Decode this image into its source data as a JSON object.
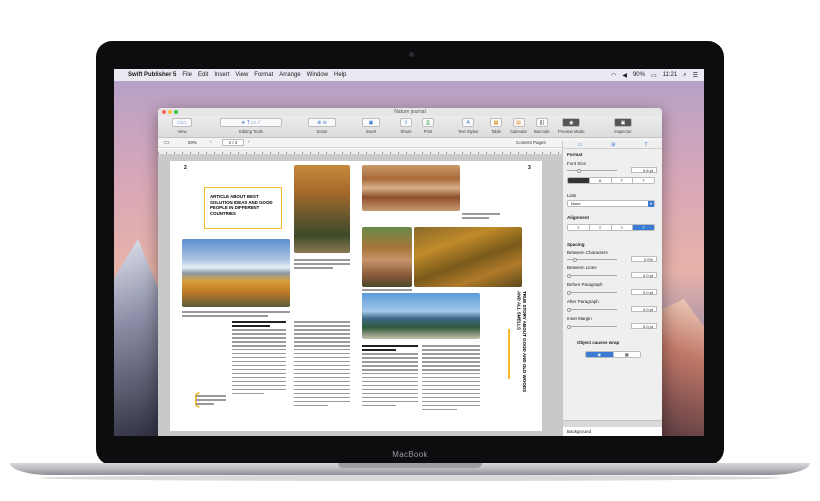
{
  "laptop": {
    "brand_label": "MacBook"
  },
  "menubar": {
    "app_name": "Swift Publisher 5",
    "items": [
      "File",
      "Edit",
      "Insert",
      "View",
      "Format",
      "Arrange",
      "Window",
      "Help"
    ],
    "battery": "90%",
    "time": "11:21"
  },
  "window": {
    "title": "Nature journal",
    "toolbar": {
      "view": "View",
      "editing_tools": "Editing Tools",
      "zoom": "Zoom",
      "insert": "Insert",
      "share": "Share",
      "print": "Print",
      "text_styles": "Text Styles",
      "table": "Table",
      "calendar": "Calendar",
      "barcode": "Barcode",
      "preview_mode": "Preview Mode",
      "inspector": "Inspector"
    },
    "subbar": {
      "zoom_value": "50%",
      "page_value": "2 / 4",
      "content_pages": "Content Pages"
    }
  },
  "document": {
    "left_page_number": "2",
    "right_page_number": "3",
    "headline": "ARTICLE ABOUT BEST SOLUTION IDEAS AND GOOD PEOPLE IN DIFFERENT COUNTRIES",
    "vertical_title": "TRUE STORY ABOUT GOOD AND OLD WOODS AND ALL SMELLS",
    "colors": {
      "accent_yellow": "#f2b827"
    }
  },
  "inspector": {
    "format_label": "Format",
    "font_size_label": "Font Size",
    "font_size_value": "9.6 pt",
    "lists_label": "Lists",
    "lists_value": "None",
    "alignment_label": "Alignment",
    "spacing_label": "Spacing",
    "between_characters_label": "Between Characters",
    "between_characters_value": "0.0%",
    "between_lines_label": "Between Lines",
    "between_lines_value": "0.0 pt",
    "before_paragraph_label": "Before Paragraph",
    "before_paragraph_value": "0.0 pt",
    "after_paragraph_label": "After Paragraph",
    "after_paragraph_value": "0.0 pt",
    "inset_margin_label": "Inset Margin",
    "inset_margin_value": "0.0 pt",
    "object_wrap_label": "Object causes wrap",
    "layers_row": "Background"
  }
}
